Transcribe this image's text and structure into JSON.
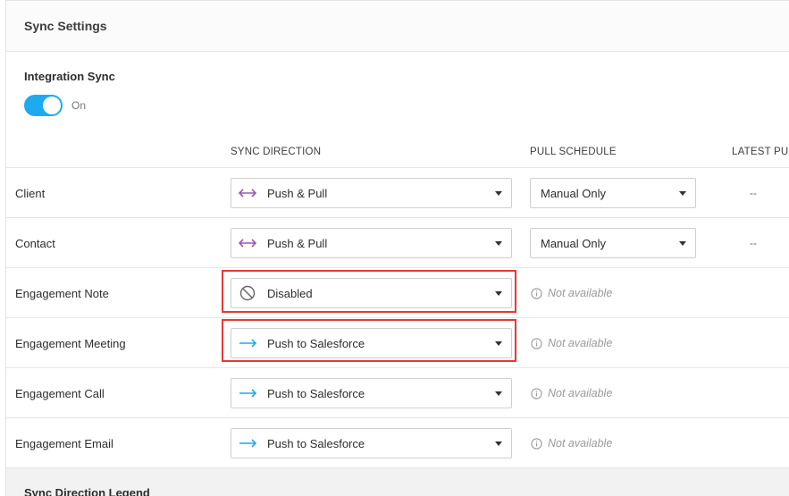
{
  "panel": {
    "title": "Sync Settings"
  },
  "integration": {
    "label": "Integration Sync",
    "toggle_state": "On",
    "toggle_on": true
  },
  "columns": {
    "sync_direction": "SYNC DIRECTION",
    "pull_schedule": "PULL SCHEDULE",
    "latest_pull": "LATEST PU"
  },
  "rows": [
    {
      "label": "Client",
      "direction": "Push & Pull",
      "direction_icon": "push-pull-icon",
      "schedule": "Manual Only",
      "latest": "--"
    },
    {
      "label": "Contact",
      "direction": "Push & Pull",
      "direction_icon": "push-pull-icon",
      "schedule": "Manual Only",
      "latest": "--"
    },
    {
      "label": "Engagement Note",
      "direction": "Disabled",
      "direction_icon": "disabled-icon",
      "schedule_status": "Not available"
    },
    {
      "label": "Engagement Meeting",
      "direction": "Push to Salesforce",
      "direction_icon": "push-arrow-icon",
      "schedule_status": "Not available"
    },
    {
      "label": "Engagement Call",
      "direction": "Push to Salesforce",
      "direction_icon": "push-arrow-icon",
      "schedule_status": "Not available"
    },
    {
      "label": "Engagement Email",
      "direction": "Push to Salesforce",
      "direction_icon": "push-arrow-icon",
      "schedule_status": "Not available"
    }
  ],
  "legend": {
    "title": "Sync Direction Legend"
  },
  "colors": {
    "toggle_on": "#1eaaf1",
    "push_pull": "#9b59b6",
    "push_arrow": "#1eaaf1",
    "highlight": "#e53935"
  }
}
